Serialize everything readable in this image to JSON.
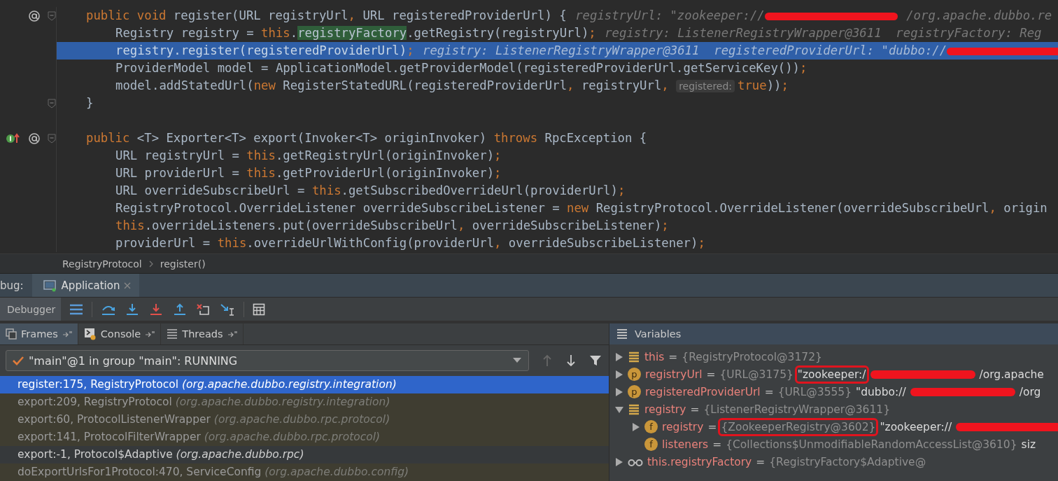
{
  "editor": {
    "lines": [
      {
        "kind": "code",
        "selected": false,
        "gutter_icons": [
          {
            "kind": "at"
          },
          {
            "kind": "fold"
          }
        ],
        "tokens": [
          {
            "kind": "kw",
            "text": "public void "
          },
          {
            "kind": "tx",
            "text": "register(URL registryUrl"
          },
          {
            "kind": "p",
            "text": ", "
          },
          {
            "kind": "tx",
            "text": "URL registeredProviderUrl) {"
          },
          {
            "kind": "hint",
            "text": "registryUrl: \"zookeeper://"
          },
          {
            "kind": "redact"
          },
          {
            "kind": "hint",
            "text": "/org.apache.dubbo.re"
          }
        ],
        "children": [
          {
            "kind": "code",
            "selected": false,
            "tokens": [
              {
                "kind": "tx",
                "text": "Registry registry = "
              },
              {
                "kind": "kw",
                "text": "this"
              },
              {
                "kind": "tx",
                "text": "."
              },
              {
                "kind": "field",
                "text": "registryFactory"
              },
              {
                "kind": "tx",
                "text": ".getRegistry(registryUrl)"
              },
              {
                "kind": "p",
                "text": ";"
              },
              {
                "kind": "hint",
                "text": "registry: ListenerRegistryWrapper@3611  registryFactory: Reg"
              }
            ]
          },
          {
            "kind": "code",
            "selected": true,
            "tokens": [
              {
                "kind": "tx",
                "text": "registry.register(registeredProviderUrl)"
              },
              {
                "kind": "p",
                "text": ";"
              },
              {
                "kind": "hint",
                "text": "registry: ListenerRegistryWrapper@3611  registeredProviderUrl: \"dubbo://"
              },
              {
                "kind": "redact"
              }
            ]
          },
          {
            "kind": "code",
            "selected": false,
            "tokens": [
              {
                "kind": "tx",
                "text": "ProviderModel model = ApplicationModel.getProviderModel(registeredProviderUrl.getServiceKey())"
              },
              {
                "kind": "p",
                "text": ";"
              }
            ]
          },
          {
            "kind": "code",
            "selected": false,
            "tokens": [
              {
                "kind": "tx",
                "text": "model.addStatedUrl("
              },
              {
                "kind": "kw",
                "text": "new "
              },
              {
                "kind": "tx",
                "text": "RegisterStatedURL(registeredProviderUrl"
              },
              {
                "kind": "p",
                "text": ", "
              },
              {
                "kind": "tx",
                "text": "registryUrl"
              },
              {
                "kind": "p",
                "text": ", "
              },
              {
                "kind": "param",
                "text": "registered:"
              },
              {
                "kind": "kw",
                "text": "true"
              },
              {
                "kind": "tx",
                "text": "))"
              },
              {
                "kind": "p",
                "text": ";"
              }
            ]
          }
        ]
      },
      {
        "kind": "code",
        "selected": false,
        "gutter_icons": [
          {
            "kind": "fold"
          }
        ],
        "tokens": [
          {
            "kind": "tx",
            "text": "}"
          }
        ]
      },
      {
        "kind": "blank",
        "selected": false
      },
      {
        "kind": "code",
        "selected": false,
        "gutter_icons": [
          {
            "kind": "impl"
          },
          {
            "kind": "at"
          },
          {
            "kind": "fold"
          }
        ],
        "tokens": [
          {
            "kind": "kw",
            "text": "public "
          },
          {
            "kind": "tx",
            "text": "<T> Exporter<T> export(Invoker<T> originInvoker) "
          },
          {
            "kind": "kw",
            "text": "throws "
          },
          {
            "kind": "tx",
            "text": "RpcException {"
          }
        ],
        "children": [
          {
            "kind": "code",
            "selected": false,
            "tokens": [
              {
                "kind": "tx",
                "text": "URL registryUrl = "
              },
              {
                "kind": "kw",
                "text": "this"
              },
              {
                "kind": "tx",
                "text": ".getRegistryUrl(originInvoker)"
              },
              {
                "kind": "p",
                "text": ";"
              }
            ]
          },
          {
            "kind": "code",
            "selected": false,
            "tokens": [
              {
                "kind": "tx",
                "text": "URL providerUrl = "
              },
              {
                "kind": "kw",
                "text": "this"
              },
              {
                "kind": "tx",
                "text": ".getProviderUrl(originInvoker)"
              },
              {
                "kind": "p",
                "text": ";"
              }
            ]
          },
          {
            "kind": "code",
            "selected": false,
            "tokens": [
              {
                "kind": "tx",
                "text": "URL overrideSubscribeUrl = "
              },
              {
                "kind": "kw",
                "text": "this"
              },
              {
                "kind": "tx",
                "text": ".getSubscribedOverrideUrl(providerUrl)"
              },
              {
                "kind": "p",
                "text": ";"
              }
            ]
          },
          {
            "kind": "code",
            "selected": false,
            "tokens": [
              {
                "kind": "tx",
                "text": "RegistryProtocol.OverrideListener overrideSubscribeListener = "
              },
              {
                "kind": "kw",
                "text": "new "
              },
              {
                "kind": "tx",
                "text": "RegistryProtocol.OverrideListener(overrideSubscribeUrl"
              },
              {
                "kind": "p",
                "text": ", "
              },
              {
                "kind": "tx",
                "text": "origin"
              }
            ]
          },
          {
            "kind": "code",
            "selected": false,
            "tokens": [
              {
                "kind": "kw",
                "text": "this"
              },
              {
                "kind": "tx",
                "text": ".overrideListeners.put(overrideSubscribeUrl"
              },
              {
                "kind": "p",
                "text": ", "
              },
              {
                "kind": "tx",
                "text": "overrideSubscribeListener)"
              },
              {
                "kind": "p",
                "text": ";"
              }
            ]
          },
          {
            "kind": "code",
            "selected": false,
            "tokens": [
              {
                "kind": "tx",
                "text": "providerUrl = "
              },
              {
                "kind": "kw",
                "text": "this"
              },
              {
                "kind": "tx",
                "text": ".overrideUrlWithConfig(providerUrl"
              },
              {
                "kind": "p",
                "text": ", "
              },
              {
                "kind": "tx",
                "text": "overrideSubscribeListener)"
              },
              {
                "kind": "p",
                "text": ";"
              }
            ]
          }
        ]
      }
    ]
  },
  "breadcrumbs": [
    "RegistryProtocol",
    "register()"
  ],
  "debug_bar": {
    "label": "bug:",
    "tabs": [
      {
        "label": "Application",
        "selected": true
      }
    ]
  },
  "toolbar": {
    "tabs": [
      {
        "label": "Debugger",
        "selected": true
      }
    ]
  },
  "frames_panel": {
    "tabs": [
      {
        "label": "Frames",
        "selected": true
      },
      {
        "label": "Console",
        "selected": false
      },
      {
        "label": "Threads",
        "selected": false
      }
    ],
    "thread": "\"main\"@1 in group \"main\": RUNNING",
    "frames": [
      {
        "method": "register:175, RegistryProtocol",
        "package": "(org.apache.dubbo.registry.integration)",
        "selected": true,
        "library": false
      },
      {
        "method": "export:209, RegistryProtocol",
        "package": "(org.apache.dubbo.registry.integration)",
        "selected": false,
        "library": true
      },
      {
        "method": "export:60, ProtocolListenerWrapper",
        "package": "(org.apache.dubbo.rpc.protocol)",
        "selected": false,
        "library": true
      },
      {
        "method": "export:141, ProtocolFilterWrapper",
        "package": "(org.apache.dubbo.rpc.protocol)",
        "selected": false,
        "library": true
      },
      {
        "method": "export:-1, Protocol$Adaptive",
        "package": "(org.apache.dubbo.rpc)",
        "selected": false,
        "library": false
      },
      {
        "method": "doExportUrlsFor1Protocol:470, ServiceConfig",
        "package": "(org.apache.dubbo.config)",
        "selected": false,
        "library": true
      }
    ]
  },
  "variables_panel": {
    "title": "Variables",
    "items": [
      {
        "kind": "object",
        "name": "this",
        "operator": "=",
        "expanded": false,
        "value": [
          {
            "kind": "ref",
            "text": "{RegistryProtocol@3172}",
            "boxed": false
          }
        ]
      },
      {
        "kind": "param",
        "badge": "p",
        "name": "registryUrl",
        "operator": "=",
        "expanded": false,
        "value": [
          {
            "kind": "ref",
            "text": "{URL@3175}",
            "boxed": false
          },
          {
            "kind": "str",
            "text": "\"zookeeper:/",
            "boxed": true
          },
          {
            "kind": "redact",
            "boxed": false
          },
          {
            "kind": "str",
            "text": "/org.apache",
            "boxed": false
          }
        ]
      },
      {
        "kind": "param",
        "badge": "p",
        "name": "registeredProviderUrl",
        "operator": "=",
        "expanded": false,
        "value": [
          {
            "kind": "ref",
            "text": "{URL@3555}",
            "boxed": false
          },
          {
            "kind": "str",
            "text": "\"dubbo://",
            "boxed": false
          },
          {
            "kind": "redact",
            "boxed": false
          },
          {
            "kind": "str",
            "text": "/org",
            "boxed": false
          }
        ]
      },
      {
        "kind": "object",
        "name": "registry",
        "operator": "=",
        "expanded": true,
        "value": [
          {
            "kind": "ref",
            "text": "{ListenerRegistryWrapper@3611}",
            "boxed": false
          }
        ],
        "children": [
          {
            "kind": "field",
            "badge": "f",
            "name": "registry",
            "operator": "=",
            "expanded": false,
            "value": [
              {
                "kind": "ref",
                "text": "{ZookeeperRegistry@3602}",
                "boxed": true
              },
              {
                "kind": "str",
                "text": "\"zookeeper://",
                "boxed": false
              },
              {
                "kind": "redact",
                "boxed": false
              }
            ]
          },
          {
            "kind": "field",
            "badge": "f",
            "name": "listeners",
            "operator": "=",
            "value": [
              {
                "kind": "ref",
                "text": "{Collections$UnmodifiableRandomAccessList@3610}",
                "boxed": false
              },
              {
                "kind": "str",
                "text": "siz",
                "boxed": false
              }
            ]
          }
        ]
      },
      {
        "kind": "watch",
        "name": "this.registryFactory",
        "operator": "=",
        "expanded": false,
        "value": [
          {
            "kind": "ref",
            "text": "{RegistryFactory$Adaptive@",
            "boxed": false
          }
        ]
      }
    ]
  }
}
